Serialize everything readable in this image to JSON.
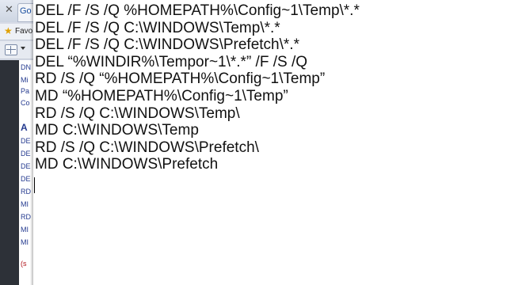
{
  "background_window": {
    "tab_title": "Go",
    "favorites_label": "Favo",
    "side_lines": [
      "DN",
      "Mi",
      "Pa",
      "Co",
      "A",
      "DE",
      "DE",
      "DE",
      "DE",
      "RD",
      "MI",
      "RD",
      "MI",
      "MI",
      "(s"
    ]
  },
  "editor": {
    "lines": [
      "DEL /F /S /Q %HOMEPATH%\\Config~1\\Temp\\*.*",
      "DEL /F /S /Q C:\\WINDOWS\\Temp\\*.*",
      "DEL /F /S /Q C:\\WINDOWS\\Prefetch\\*.*",
      "DEL “%WINDIR%\\Tempor~1\\*.*” /F /S /Q",
      "RD /S /Q “%HOMEPATH%\\Config~1\\Temp”",
      "MD “%HOMEPATH%\\Config~1\\Temp”",
      "RD /S /Q C:\\WINDOWS\\Temp\\",
      "MD C:\\WINDOWS\\Temp",
      "RD /S /Q C:\\WINDOWS\\Prefetch\\",
      "MD C:\\WINDOWS\\Prefetch"
    ]
  },
  "colors": {
    "editor_background": "#ffffff",
    "text": "#111111",
    "side_text_blue": "#243a8f",
    "side_text_red": "#b0141b"
  },
  "icons": {
    "close": "close-icon",
    "favorites": "star-icon",
    "view": "grid-view-icon",
    "dropdown": "chevron-down-icon"
  }
}
